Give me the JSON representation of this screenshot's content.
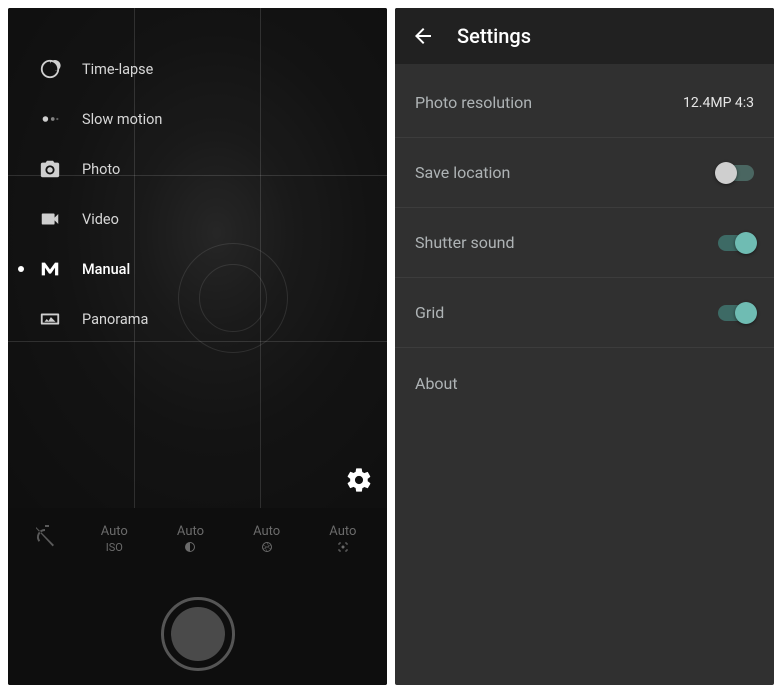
{
  "camera": {
    "modes": [
      {
        "id": "timelapse",
        "label": "Time-lapse",
        "icon": "timelapse-icon",
        "active": false
      },
      {
        "id": "slowmotion",
        "label": "Slow motion",
        "icon": "slowmotion-icon",
        "active": false
      },
      {
        "id": "photo",
        "label": "Photo",
        "icon": "photo-icon",
        "active": false
      },
      {
        "id": "video",
        "label": "Video",
        "icon": "video-icon",
        "active": false
      },
      {
        "id": "manual",
        "label": "Manual",
        "icon": "manual-icon",
        "active": true
      },
      {
        "id": "panorama",
        "label": "Panorama",
        "icon": "panorama-icon",
        "active": false
      }
    ],
    "manual_bar": {
      "timer_off": true,
      "controls": [
        {
          "top": "Auto",
          "sub": "ISO",
          "name": "iso-control"
        },
        {
          "top": "Auto",
          "sub": "",
          "name": "exposure-control",
          "icon": "contrast-icon"
        },
        {
          "top": "Auto",
          "sub": "",
          "name": "aperture-control",
          "icon": "aperture-icon"
        },
        {
          "top": "Auto",
          "sub": "",
          "name": "focus-control",
          "icon": "focus-icon"
        }
      ]
    }
  },
  "settings": {
    "title": "Settings",
    "items": [
      {
        "label": "Photo resolution",
        "value": "12.4MP 4:3",
        "type": "value"
      },
      {
        "label": "Save location",
        "type": "switch",
        "state": "partial"
      },
      {
        "label": "Shutter sound",
        "type": "switch",
        "state": "on"
      },
      {
        "label": "Grid",
        "type": "switch",
        "state": "on"
      },
      {
        "label": "About",
        "type": "link"
      }
    ]
  },
  "colors": {
    "toggle_on": "#6fbcb3",
    "toggle_track_on": "#3d6a65",
    "bg_settings": "#303030",
    "bg_appbar": "#212121"
  }
}
